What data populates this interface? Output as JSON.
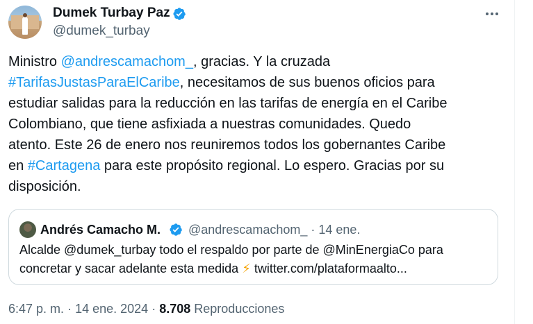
{
  "author": {
    "display_name": "Dumek Turbay Paz",
    "handle": "@dumek_turbay",
    "verified": true
  },
  "tweet": {
    "t1": "Ministro ",
    "mention": "@andrescamachom_",
    "t2": ", gracias. Y la cruzada\n",
    "hashtag1": "#TarifasJustasParaElCaribe",
    "t3": ", necesitamos de sus buenos oficios para\nestudiar salidas para la reducción en las tarifas de energía en el Caribe\nColombiano, que tiene asfixiada a nuestras comunidades. Quedo\natento. Este 26 de enero nos reuniremos todos los gobernantes Caribe\nen ",
    "hashtag2": "#Cartagena",
    "t4": " para este propósito regional. Lo espero. Gracias por su\ndisposición."
  },
  "quote": {
    "display_name": "Andrés Camacho M.",
    "handle": "@andrescamachom_",
    "separator": "·",
    "date": "14 ene.",
    "verified": true,
    "text_line1": "Alcalde @dumek_turbay todo el respaldo por parte de @MinEnergiaCo para",
    "text_line2_pre": "concretar y sacar adelante esta medida ",
    "emoji": "⚡",
    "text_line2_post": " twitter.com/plataformaalto..."
  },
  "footer": {
    "time": "6:47 p. m.",
    "sep1": "·",
    "date": "14 ene. 2024",
    "sep2": "·",
    "views": "8.708",
    "views_label": "Reproducciones"
  },
  "colors": {
    "link": "#1d9bf0",
    "verified": "#1d9bf0",
    "muted": "#536471",
    "text": "#0f1419"
  },
  "icons": {
    "verified": "verified-badge-icon",
    "more": "more-options-icon"
  }
}
